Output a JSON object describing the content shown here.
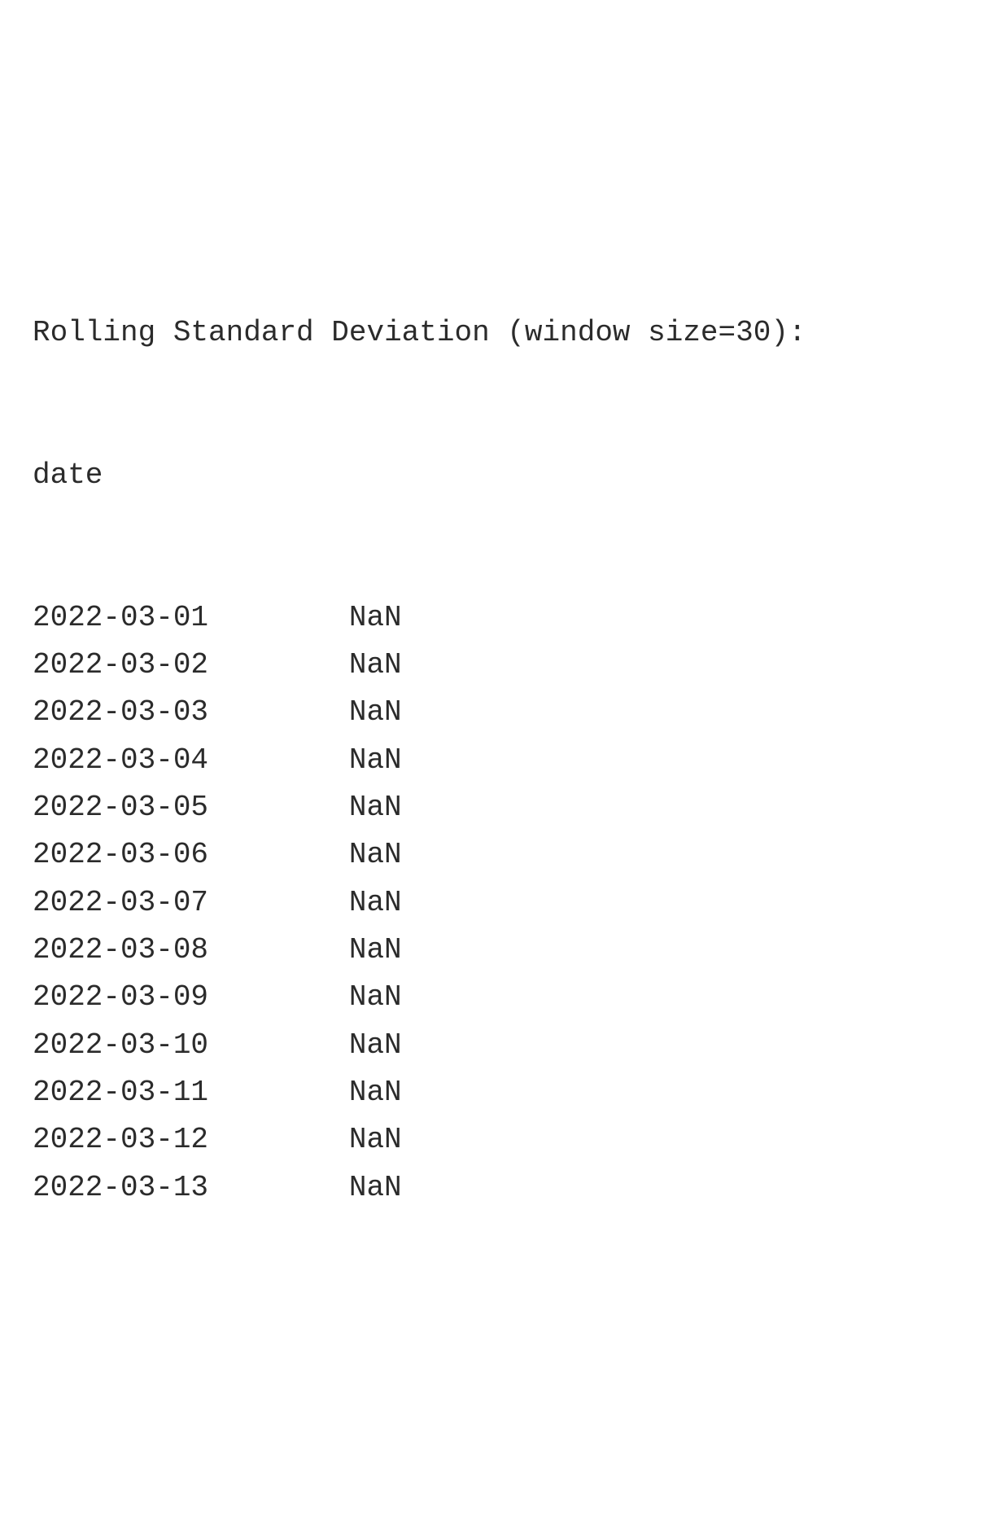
{
  "output": {
    "title": "Rolling Standard Deviation (window size=30):",
    "index_name": "date",
    "rows": [
      {
        "date": "2022-03-01",
        "value": "NaN"
      },
      {
        "date": "2022-03-02",
        "value": "NaN"
      },
      {
        "date": "2022-03-03",
        "value": "NaN"
      },
      {
        "date": "2022-03-04",
        "value": "NaN"
      },
      {
        "date": "2022-03-05",
        "value": "NaN"
      },
      {
        "date": "2022-03-06",
        "value": "NaN"
      },
      {
        "date": "2022-03-07",
        "value": "NaN"
      },
      {
        "date": "2022-03-08",
        "value": "NaN"
      },
      {
        "date": "2022-03-09",
        "value": "NaN"
      },
      {
        "date": "2022-03-10",
        "value": "NaN"
      },
      {
        "date": "2022-03-11",
        "value": "NaN"
      },
      {
        "date": "2022-03-12",
        "value": "NaN"
      },
      {
        "date": "2022-03-13",
        "value": "NaN"
      }
    ]
  }
}
